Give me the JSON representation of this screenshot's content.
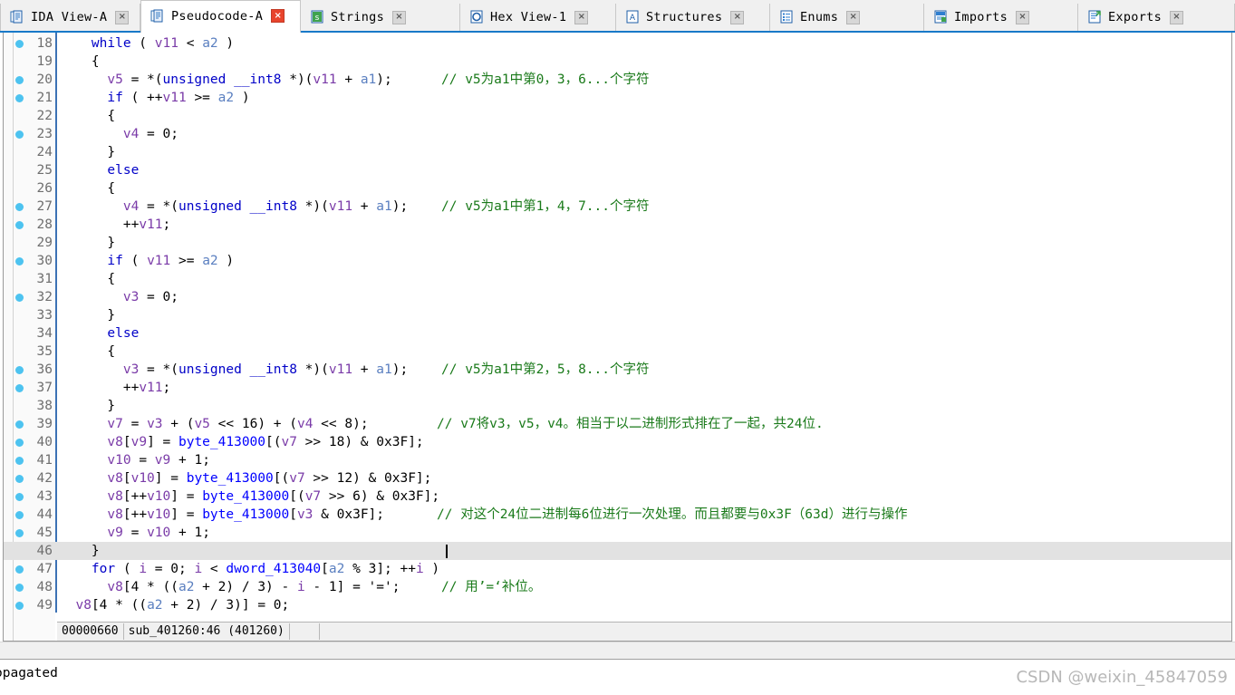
{
  "app": {
    "name": "IDA Pro",
    "watermark": "CSDN @weixin_45847059"
  },
  "tabs": [
    {
      "label": "IDA View-A",
      "icon": "document-blue-icon",
      "active": false,
      "close_label": "×"
    },
    {
      "label": "Pseudocode-A",
      "icon": "document-blue-icon",
      "active": true,
      "close_label": "×"
    },
    {
      "label": "Strings",
      "icon": "strings-green-icon",
      "active": false,
      "close_label": "×"
    },
    {
      "label": "Hex View-1",
      "icon": "hex-circle-icon",
      "active": false,
      "close_label": "×"
    },
    {
      "label": "Structures",
      "icon": "structures-a-icon",
      "active": false,
      "close_label": "×"
    },
    {
      "label": "Enums",
      "icon": "enums-list-icon",
      "active": false,
      "close_label": "×"
    },
    {
      "label": "Imports",
      "icon": "imports-icon",
      "active": false,
      "close_label": "×"
    },
    {
      "label": "Exports",
      "icon": "exports-icon",
      "active": false,
      "close_label": "×"
    }
  ],
  "editor": {
    "current_line": 46,
    "caret_line": 46,
    "lines": [
      {
        "n": 18,
        "dot": true,
        "indent": 2,
        "code": "while ( v11 < a2 )",
        "comment": ""
      },
      {
        "n": 19,
        "dot": false,
        "indent": 2,
        "code": "{",
        "comment": ""
      },
      {
        "n": 20,
        "dot": true,
        "indent": 3,
        "code": "v5 = *(unsigned __int8 *)(v11 + a1);",
        "comment": "// v5为a1中第0，3，6...个字符"
      },
      {
        "n": 21,
        "dot": true,
        "indent": 3,
        "code": "if ( ++v11 >= a2 )",
        "comment": ""
      },
      {
        "n": 22,
        "dot": false,
        "indent": 3,
        "code": "{",
        "comment": ""
      },
      {
        "n": 23,
        "dot": true,
        "indent": 4,
        "code": "v4 = 0;",
        "comment": ""
      },
      {
        "n": 24,
        "dot": false,
        "indent": 3,
        "code": "}",
        "comment": ""
      },
      {
        "n": 25,
        "dot": false,
        "indent": 3,
        "code": "else",
        "comment": ""
      },
      {
        "n": 26,
        "dot": false,
        "indent": 3,
        "code": "{",
        "comment": ""
      },
      {
        "n": 27,
        "dot": true,
        "indent": 4,
        "code": "v4 = *(unsigned __int8 *)(v11 + a1);",
        "comment": "// v5为a1中第1，4，7...个字符"
      },
      {
        "n": 28,
        "dot": true,
        "indent": 4,
        "code": "++v11;",
        "comment": ""
      },
      {
        "n": 29,
        "dot": false,
        "indent": 3,
        "code": "}",
        "comment": ""
      },
      {
        "n": 30,
        "dot": true,
        "indent": 3,
        "code": "if ( v11 >= a2 )",
        "comment": ""
      },
      {
        "n": 31,
        "dot": false,
        "indent": 3,
        "code": "{",
        "comment": ""
      },
      {
        "n": 32,
        "dot": true,
        "indent": 4,
        "code": "v3 = 0;",
        "comment": ""
      },
      {
        "n": 33,
        "dot": false,
        "indent": 3,
        "code": "}",
        "comment": ""
      },
      {
        "n": 34,
        "dot": false,
        "indent": 3,
        "code": "else",
        "comment": ""
      },
      {
        "n": 35,
        "dot": false,
        "indent": 3,
        "code": "{",
        "comment": ""
      },
      {
        "n": 36,
        "dot": true,
        "indent": 4,
        "code": "v3 = *(unsigned __int8 *)(v11 + a1);",
        "comment": "// v5为a1中第2，5，8...个字符"
      },
      {
        "n": 37,
        "dot": true,
        "indent": 4,
        "code": "++v11;",
        "comment": ""
      },
      {
        "n": 38,
        "dot": false,
        "indent": 3,
        "code": "}",
        "comment": ""
      },
      {
        "n": 39,
        "dot": true,
        "indent": 3,
        "code": "v7 = v3 + (v5 << 16) + (v4 << 8);",
        "comment": "// v7将v3，v5，v4。相当于以二进制形式排在了一起，共24位."
      },
      {
        "n": 40,
        "dot": true,
        "indent": 3,
        "code": "v8[v9] = byte_413000[(v7 >> 18) & 0x3F];",
        "comment": ""
      },
      {
        "n": 41,
        "dot": true,
        "indent": 3,
        "code": "v10 = v9 + 1;",
        "comment": ""
      },
      {
        "n": 42,
        "dot": true,
        "indent": 3,
        "code": "v8[v10] = byte_413000[(v7 >> 12) & 0x3F];",
        "comment": ""
      },
      {
        "n": 43,
        "dot": true,
        "indent": 3,
        "code": "v8[++v10] = byte_413000[(v7 >> 6) & 0x3F];",
        "comment": ""
      },
      {
        "n": 44,
        "dot": true,
        "indent": 3,
        "code": "v8[++v10] = byte_413000[v3 & 0x3F];",
        "comment": "// 对这个24位二进制每6位进行一次处理。而且都要与0x3F（63d）进行与操作"
      },
      {
        "n": 45,
        "dot": true,
        "indent": 3,
        "code": "v9 = v10 + 1;",
        "comment": ""
      },
      {
        "n": 46,
        "dot": false,
        "indent": 2,
        "code": "}",
        "comment": ""
      },
      {
        "n": 47,
        "dot": true,
        "indent": 2,
        "code": "for ( i = 0; i < dword_413040[a2 % 3]; ++i )",
        "comment": ""
      },
      {
        "n": 48,
        "dot": true,
        "indent": 3,
        "code": "v8[4 * ((a2 + 2) / 3) - i - 1] = '=';",
        "comment": "// 用’=‘补位。"
      },
      {
        "n": 49,
        "dot": true,
        "indent": 1,
        "code": "v8[4 * ((a2 + 2) / 3)] = 0;",
        "comment": ""
      }
    ]
  },
  "statusbar": {
    "offset": "00000660",
    "location": "sub_401260:46  (401260)"
  },
  "output": {
    "text": "opagated"
  },
  "colors": {
    "keyword": "#0000c8",
    "local_var": "#7a3ba8",
    "argument": "#5a7fc0",
    "global_var": "#0000ff",
    "comment": "#1a7a1a",
    "current_line_bg": "#e2e2e2",
    "tab_accent": "#1879c8",
    "dot": "#4dc3f0"
  }
}
